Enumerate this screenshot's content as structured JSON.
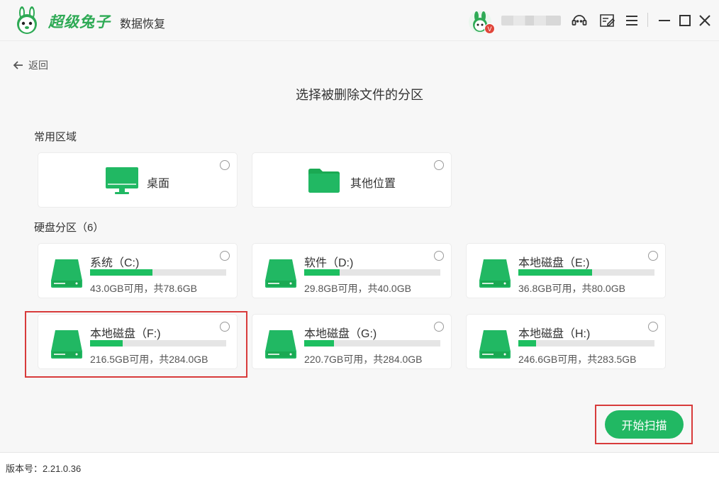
{
  "app": {
    "brand": "超级兔子",
    "subtitle": "数据恢复",
    "vip_badge": "V",
    "accent_color": "#21b863"
  },
  "titlebar_icons": [
    "support-icon",
    "feedback-icon",
    "menu-icon",
    "minimize-icon",
    "maximize-icon",
    "close-icon"
  ],
  "nav": {
    "back_label": "返回"
  },
  "page_title": "选择被删除文件的分区",
  "common": {
    "label": "常用区域",
    "items": [
      {
        "label": "桌面",
        "icon": "monitor-icon"
      },
      {
        "label": "其他位置",
        "icon": "folder-icon"
      }
    ]
  },
  "disks": {
    "label": "硬盘分区（6）",
    "items": [
      {
        "name": "系统（C:)",
        "info": "43.0GB可用，共78.6GB",
        "used_fraction": 0.46
      },
      {
        "name": "软件（D:)",
        "info": "29.8GB可用，共40.0GB",
        "used_fraction": 0.26
      },
      {
        "name": "本地磁盘（E:)",
        "info": "36.8GB可用，共80.0GB",
        "used_fraction": 0.54
      },
      {
        "name": "本地磁盘（F:)",
        "info": "216.5GB可用，共284.0GB",
        "used_fraction": 0.24
      },
      {
        "name": "本地磁盘（G:)",
        "info": "220.7GB可用，共284.0GB",
        "used_fraction": 0.22
      },
      {
        "name": "本地磁盘（H:)",
        "info": "246.6GB可用，共283.5GB",
        "used_fraction": 0.13
      }
    ]
  },
  "actions": {
    "start_scan": "开始扫描"
  },
  "footer": {
    "version": "版本号：2.21.0.36"
  }
}
